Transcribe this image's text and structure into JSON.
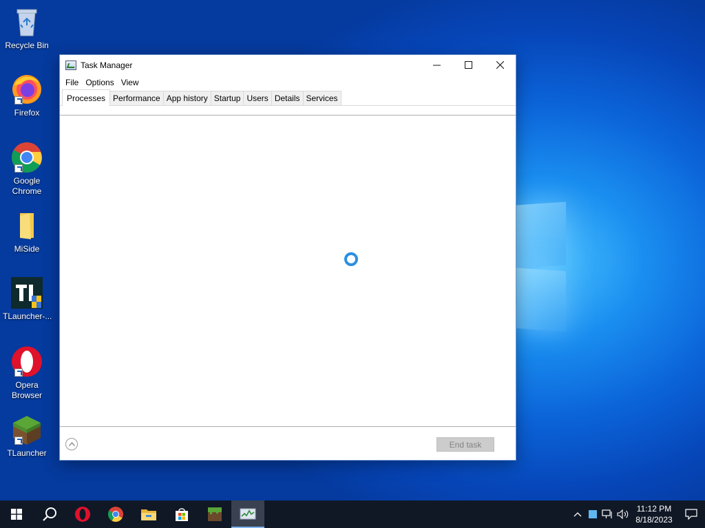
{
  "desktop": {
    "icons": [
      {
        "label": "Recycle Bin",
        "icon": "recycle-bin-icon"
      },
      {
        "label": "Firefox",
        "icon": "firefox-icon"
      },
      {
        "label": "Google Chrome",
        "icon": "chrome-icon"
      },
      {
        "label": "MiSide",
        "icon": "folder-icon"
      },
      {
        "label": "TLauncher-...",
        "icon": "tlauncher-installer-icon"
      },
      {
        "label": "Opera Browser",
        "icon": "opera-icon"
      },
      {
        "label": "TLauncher",
        "icon": "minecraft-grass-block-icon"
      }
    ]
  },
  "task_manager": {
    "title": "Task Manager",
    "menu": [
      "File",
      "Options",
      "View"
    ],
    "tabs": [
      "Processes",
      "Performance",
      "App history",
      "Startup",
      "Users",
      "Details",
      "Services"
    ],
    "active_tab": "Processes",
    "end_task_label": "End task",
    "loading": true
  },
  "taskbar": {
    "items": [
      "start-icon",
      "search-icon",
      "opera-icon",
      "chrome-icon",
      "file-explorer-icon",
      "store-icon",
      "minecraft-icon",
      "task-manager-icon"
    ],
    "active_item": "task-manager-icon",
    "time": "11:12 PM",
    "date": "8/18/2023"
  },
  "colors": {
    "accent": "#0b63d8",
    "spinner": "#2b8fe0",
    "taskbar": "#101826"
  }
}
